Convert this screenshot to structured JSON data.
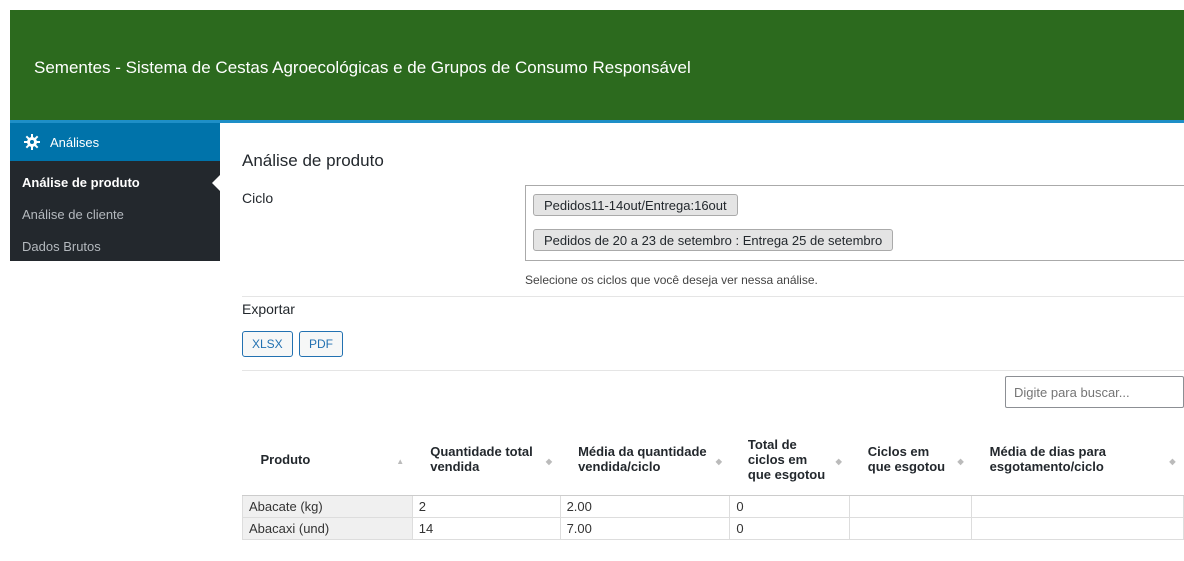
{
  "header": {
    "title": "Sementes - Sistema de Cestas Agroecológicas e de Grupos de Consumo Responsável"
  },
  "sidebar": {
    "menu_label": "Análises",
    "items": [
      {
        "label": "Análise de produto"
      },
      {
        "label": "Análise de cliente"
      },
      {
        "label": "Dados Brutos"
      }
    ]
  },
  "main": {
    "title": "Análise de produto",
    "ciclo_label": "Ciclo",
    "ciclos": [
      "Pedidos11-14out/Entrega:16out",
      "Pedidos de 20 a 23 de setembro : Entrega 25 de setembro"
    ],
    "ciclo_help": "Selecione os ciclos que você deseja ver nessa análise.",
    "export_label": "Exportar",
    "export_buttons": [
      "XLSX",
      "PDF"
    ],
    "search_placeholder": "Digite para buscar...",
    "table": {
      "columns": [
        "Produto",
        "Quantidade total vendida",
        "Média da quantidade vendida/ciclo",
        "Total de ciclos em que esgotou",
        "Ciclos em que esgotou",
        "Média de dias para esgotamento/ciclo"
      ],
      "rows": [
        [
          "Abacate (kg)",
          "2",
          "2.00",
          "0",
          "",
          ""
        ],
        [
          "Abacaxi (und)",
          "14",
          "7.00",
          "0",
          "",
          ""
        ]
      ]
    }
  },
  "colors": {
    "header_bg": "#2c6a1e",
    "accent": "#0073aa",
    "sidebar_bg": "#23282d"
  }
}
